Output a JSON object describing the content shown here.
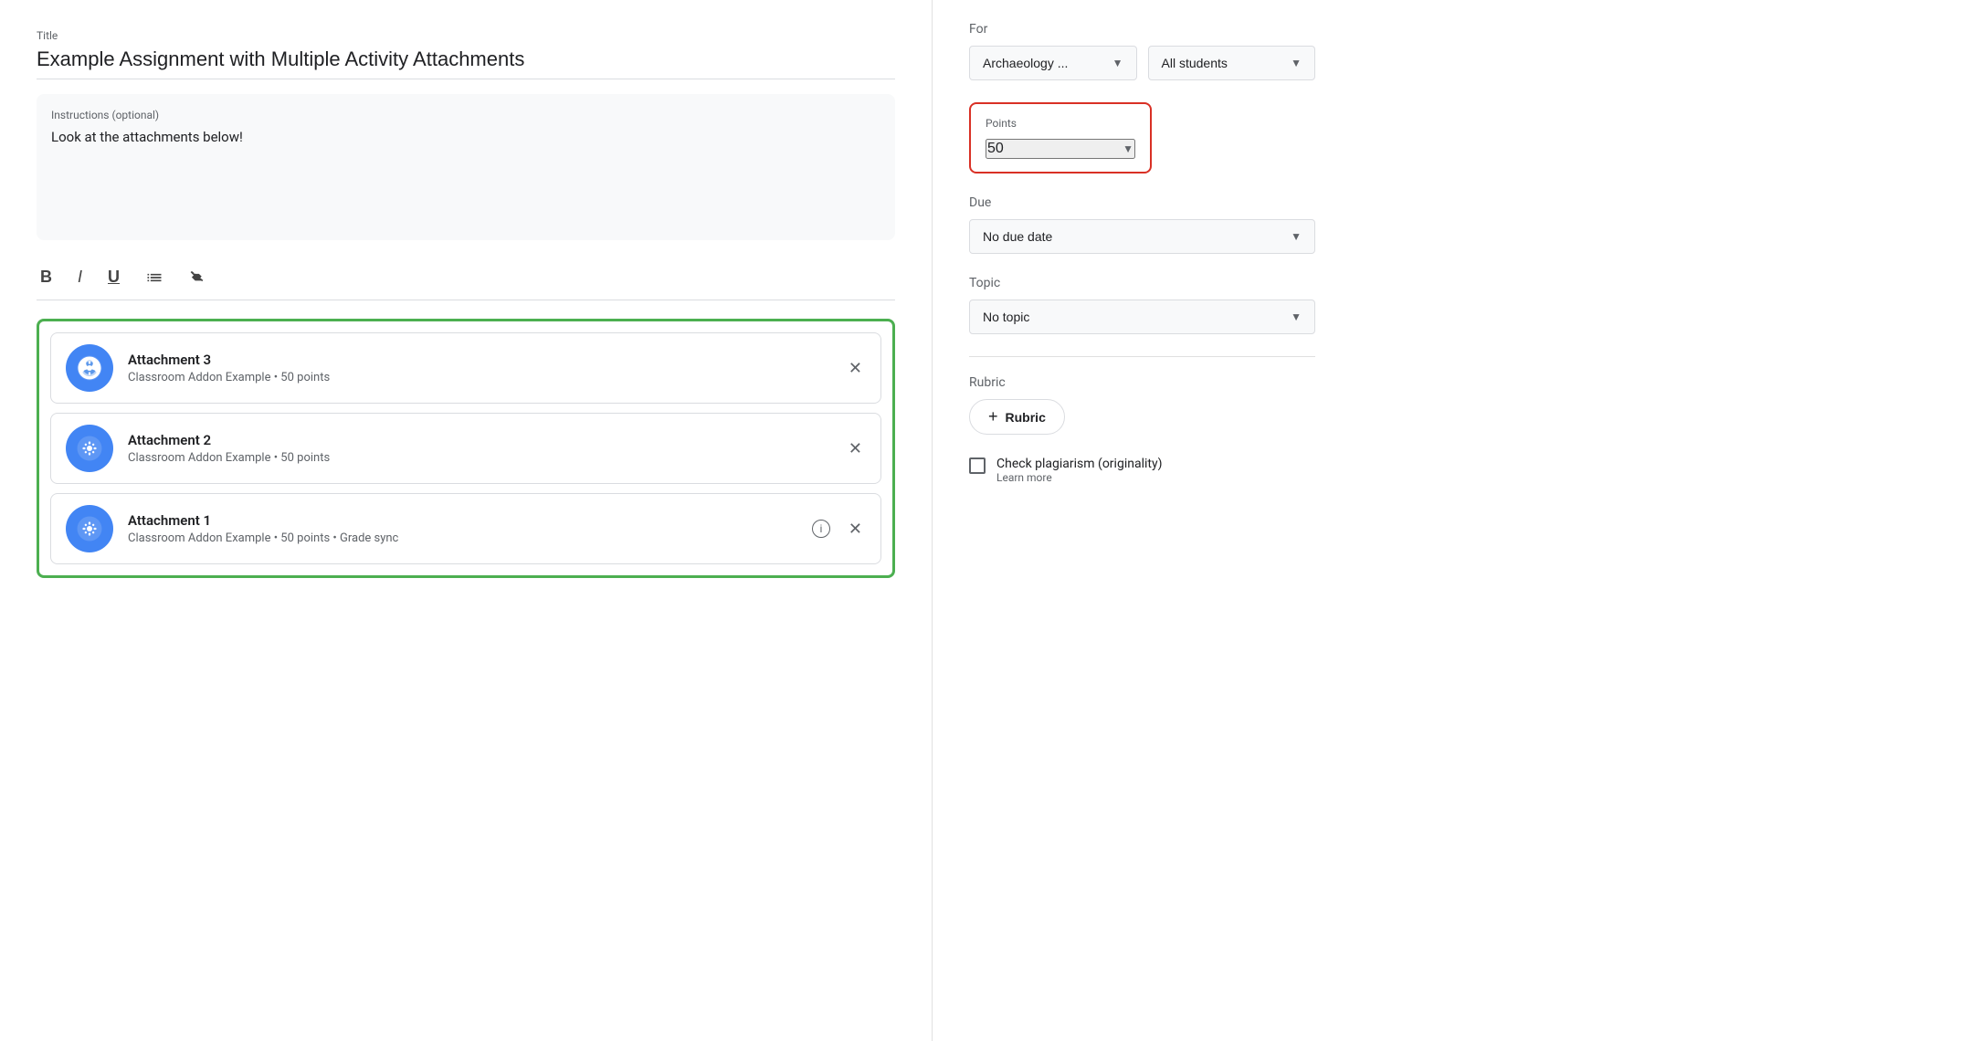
{
  "left": {
    "title_label": "Title",
    "title_value": "Example Assignment with Multiple Activity Attachments",
    "instructions_label": "Instructions (optional)",
    "instructions_value": "Look at the attachments below!",
    "toolbar": {
      "bold": "B",
      "italic": "I",
      "underline": "U",
      "list": "≡",
      "clear": "✕"
    },
    "attachments": [
      {
        "name": "Attachment 3",
        "meta": "Classroom Addon Example • 50 points",
        "has_info": false
      },
      {
        "name": "Attachment 2",
        "meta": "Classroom Addon Example • 50 points",
        "has_info": false
      },
      {
        "name": "Attachment 1",
        "meta": "Classroom Addon Example • 50 points • Grade sync",
        "has_info": true
      }
    ]
  },
  "right": {
    "for_label": "For",
    "class_value": "Archaeology ...",
    "students_value": "All students",
    "points_label": "Points",
    "points_value": "50",
    "due_label": "Due",
    "due_value": "No due date",
    "topic_label": "Topic",
    "topic_value": "No topic",
    "rubric_label": "Rubric",
    "rubric_btn_label": "Rubric",
    "rubric_plus": "+",
    "plagiarism_label": "Check plagiarism (originality)",
    "learn_more": "Learn more"
  }
}
